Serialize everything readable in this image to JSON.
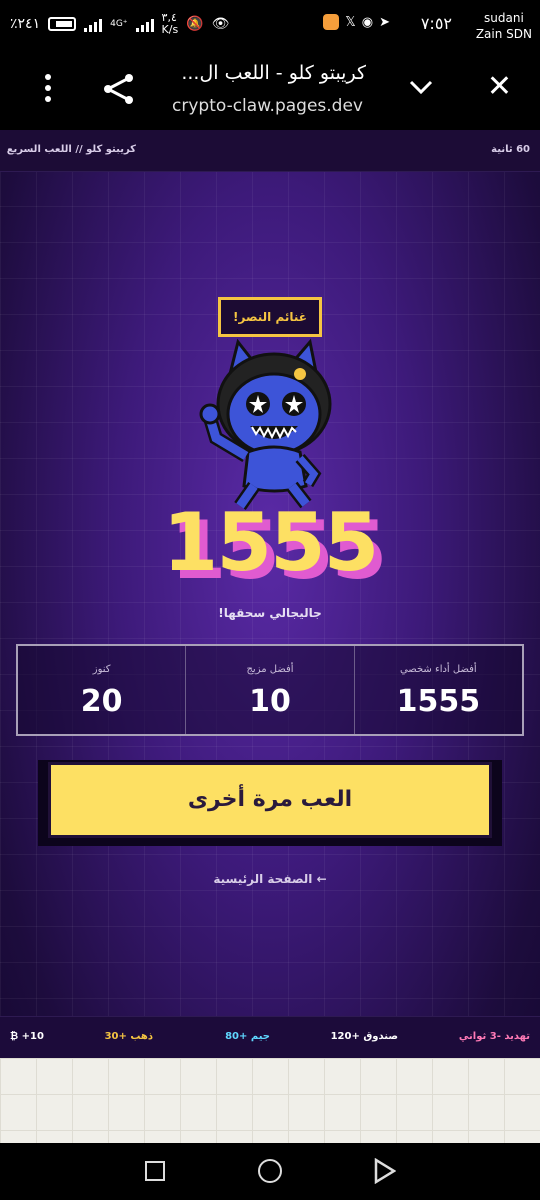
{
  "status_bar": {
    "battery": "٪٢٤١",
    "network": "4G⁺",
    "speed": "٣,٤\nK/s",
    "time": "٧:٥٢",
    "carrier": "sudani\nZain SDN"
  },
  "browser": {
    "title": "كريبتو كلو - اللعب ال...",
    "url": "crypto-claw.pages.dev"
  },
  "game": {
    "breadcrumb": "كريبتو كلو // اللعب السريع",
    "timer": "60 ثانية",
    "badge": "غنائم النصر!",
    "score": "1555",
    "subtext": "جاليجالي سحقها!",
    "stats": [
      {
        "label": "أفضل أداء شخصي",
        "value": "1555"
      },
      {
        "label": "أفضل مزيج",
        "value": "10"
      },
      {
        "label": "كنوز",
        "value": "20"
      }
    ],
    "play_again": "العب مرة أخرى",
    "home_link": "← الصفحة الرئيسية",
    "ticker": [
      {
        "text": "تهديد -3 ثواني",
        "color": "#ff7ab6"
      },
      {
        "text": "صندوق +120",
        "color": "#ffffff"
      },
      {
        "text": "جيم +80",
        "color": "#5fd8ff"
      },
      {
        "text": "ذهب +30",
        "color": "#f5c542"
      },
      {
        "text": "₿ +10",
        "color": "#ffffff"
      }
    ]
  },
  "colors": {
    "accent_yellow": "#fde063",
    "accent_pink": "#e05bd0",
    "background_purple": "#3d1a7a"
  }
}
